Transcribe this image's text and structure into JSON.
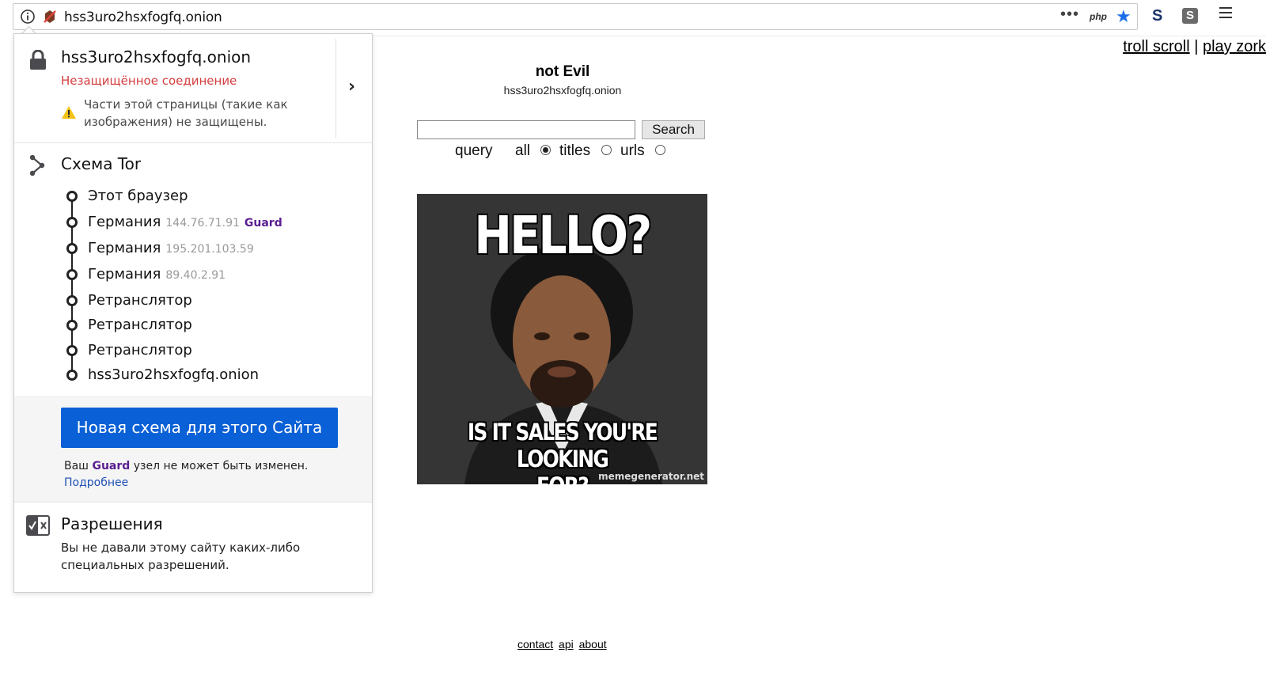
{
  "browser": {
    "url": "hss3uro2hsxfogfq.onion",
    "page_action_php": "php",
    "extension_s_label": "S",
    "extension_s2_label": "S"
  },
  "page": {
    "top_links": [
      "troll scroll",
      "play zork"
    ],
    "top_links_separator": "|",
    "title": "not Evil",
    "subtitle": "hss3uro2hsxfogfq.onion",
    "search_value": "",
    "search_button": "Search",
    "query_label": "query",
    "radio_options": [
      {
        "label": "all",
        "checked": true
      },
      {
        "label": "titles",
        "checked": false
      },
      {
        "label": "urls",
        "checked": false
      }
    ],
    "meme": {
      "top_text": "HELLO?",
      "bottom_text_line1": "IS IT SALES YOU'RE LOOKING",
      "bottom_text_line2": "FOR?",
      "watermark": "memegenerator.net"
    },
    "footer_links": [
      "contact",
      "api",
      "about"
    ]
  },
  "identity_panel": {
    "host": "hss3uro2hsxfogfq.onion",
    "connection_status": "Незащищённое соединение",
    "mixed_content_warning": "Части этой страницы (такие как изображения) не защищены.",
    "circuit_title": "Схема Tor",
    "circuit_nodes": [
      {
        "name": "Этот браузер",
        "ip": "",
        "role": ""
      },
      {
        "name": "Германия",
        "ip": "144.76.71.91",
        "role": "Guard"
      },
      {
        "name": "Германия",
        "ip": "195.201.103.59",
        "role": ""
      },
      {
        "name": "Германия",
        "ip": "89.40.2.91",
        "role": ""
      },
      {
        "name": "Ретранслятор",
        "ip": "",
        "role": ""
      },
      {
        "name": "Ретранслятор",
        "ip": "",
        "role": ""
      },
      {
        "name": "Ретранслятор",
        "ip": "",
        "role": ""
      },
      {
        "name": "hss3uro2hsxfogfq.onion",
        "ip": "",
        "role": ""
      }
    ],
    "new_circuit_button": "Новая схема для этого Сайта",
    "guard_note_prefix": "Ваш",
    "guard_note_word": "Guard",
    "guard_note_suffix": "узел не может быть изменен.",
    "learn_more": "Подробнее",
    "permissions_title": "Разрешения",
    "permissions_text": "Вы не давали этому сайту каких-либо специальных разрешений."
  },
  "colors": {
    "insecure_red": "#d43e3e",
    "button_blue": "#0a60d6",
    "guard_purple": "#5a1e91",
    "star_blue": "#1d6fe8"
  }
}
